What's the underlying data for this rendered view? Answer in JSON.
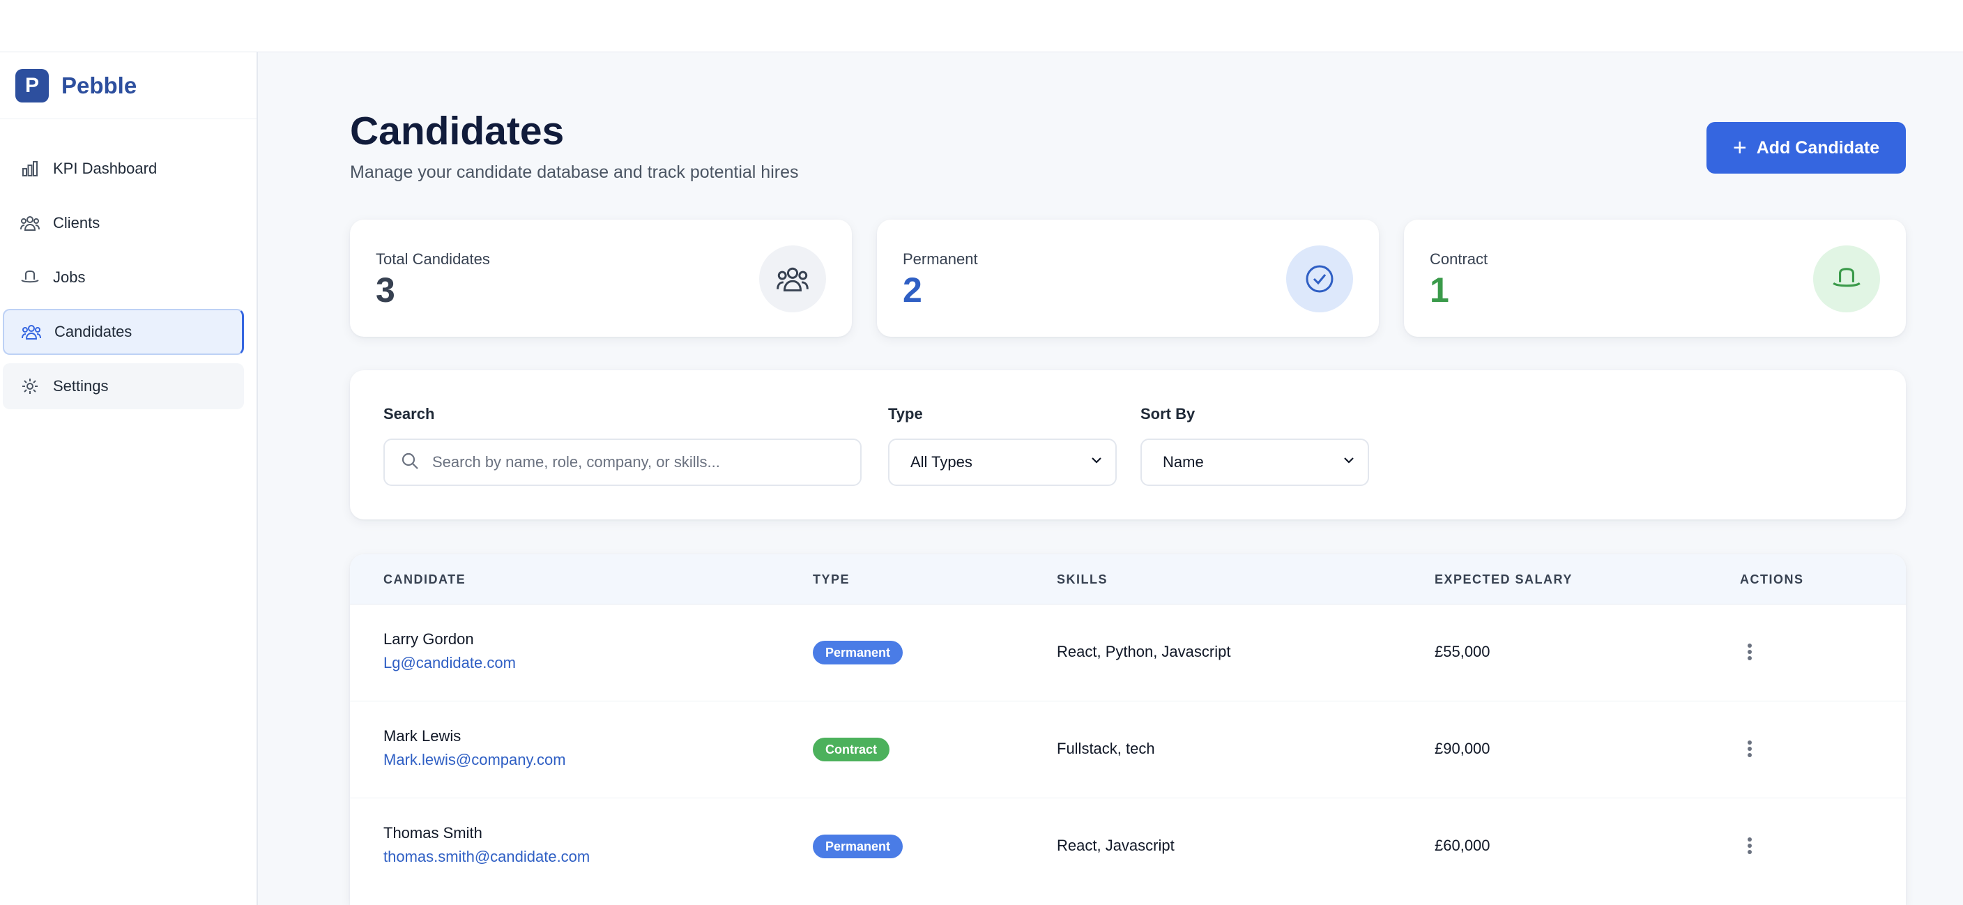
{
  "app": {
    "logo_letter": "P",
    "name": "Pebble"
  },
  "sidebar": {
    "items": [
      {
        "label": "KPI Dashboard",
        "icon": "bar-chart-icon"
      },
      {
        "label": "Clients",
        "icon": "users-icon"
      },
      {
        "label": "Jobs",
        "icon": "hat-icon"
      },
      {
        "label": "Candidates",
        "icon": "people-icon",
        "active": true
      },
      {
        "label": "Settings",
        "icon": "gear-icon"
      }
    ]
  },
  "header": {
    "title": "Candidates",
    "subtitle": "Manage your candidate database and track potential hires",
    "add_button": "Add Candidate"
  },
  "stats": [
    {
      "label": "Total Candidates",
      "value": "3",
      "color": "#374151",
      "icon": "people-icon"
    },
    {
      "label": "Permanent",
      "value": "2",
      "color": "#2f5fc4",
      "icon": "check-circle-icon"
    },
    {
      "label": "Contract",
      "value": "1",
      "color": "#3a9a4a",
      "icon": "hat-icon"
    }
  ],
  "filters": {
    "search_label": "Search",
    "search_placeholder": "Search by name, role, company, or skills...",
    "type_label": "Type",
    "type_value": "All Types",
    "sort_label": "Sort By",
    "sort_value": "Name"
  },
  "table": {
    "columns": [
      "CANDIDATE",
      "TYPE",
      "SKILLS",
      "EXPECTED SALARY",
      "ACTIONS"
    ],
    "rows": [
      {
        "name": "Larry Gordon",
        "email": "Lg@candidate.com",
        "type": "Permanent",
        "skills": "React, Python, Javascript",
        "salary": "£55,000"
      },
      {
        "name": "Mark Lewis",
        "email": "Mark.lewis@company.com",
        "type": "Contract",
        "skills": "Fullstack, tech",
        "salary": "£90,000"
      },
      {
        "name": "Thomas Smith",
        "email": "thomas.smith@candidate.com",
        "type": "Permanent",
        "skills": "React, Javascript",
        "salary": "£60,000"
      }
    ]
  }
}
